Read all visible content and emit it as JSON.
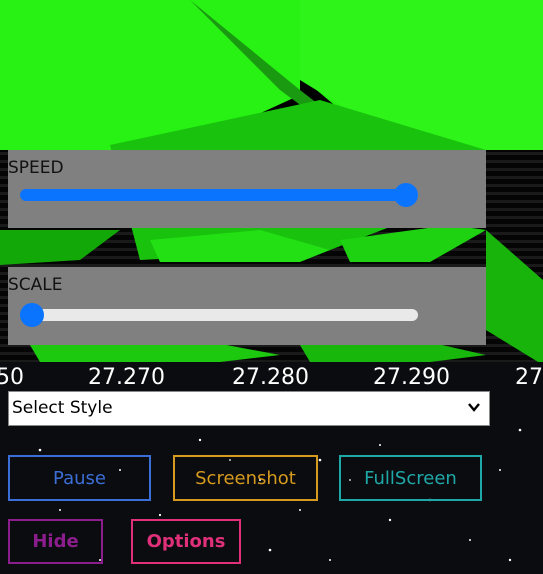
{
  "panels": {
    "speed": {
      "label": "SPEED",
      "value": 0.97
    },
    "scale": {
      "label": "SCALE",
      "value": 0.03
    }
  },
  "axis": {
    "ticks": [
      "50",
      "27.270",
      "27.280",
      "27.290",
      "27"
    ]
  },
  "style_select": {
    "selected": "Select Style"
  },
  "buttons": {
    "pause": {
      "label": "Pause",
      "color": "#3b6ed6"
    },
    "screenshot": {
      "label": "Screenshot",
      "color": "#d69a1e"
    },
    "fullscreen": {
      "label": "FullScreen",
      "color": "#1fa8a8"
    },
    "hide": {
      "label": "Hide",
      "color": "#8c1d8c"
    },
    "options": {
      "label": "Options",
      "color": "#e0307a"
    }
  },
  "colors": {
    "slider_accent": "#0a74ff",
    "slider_track_empty": "#e9e9e9",
    "panel_bg": "#808080",
    "scene_green": "#2ae812"
  }
}
